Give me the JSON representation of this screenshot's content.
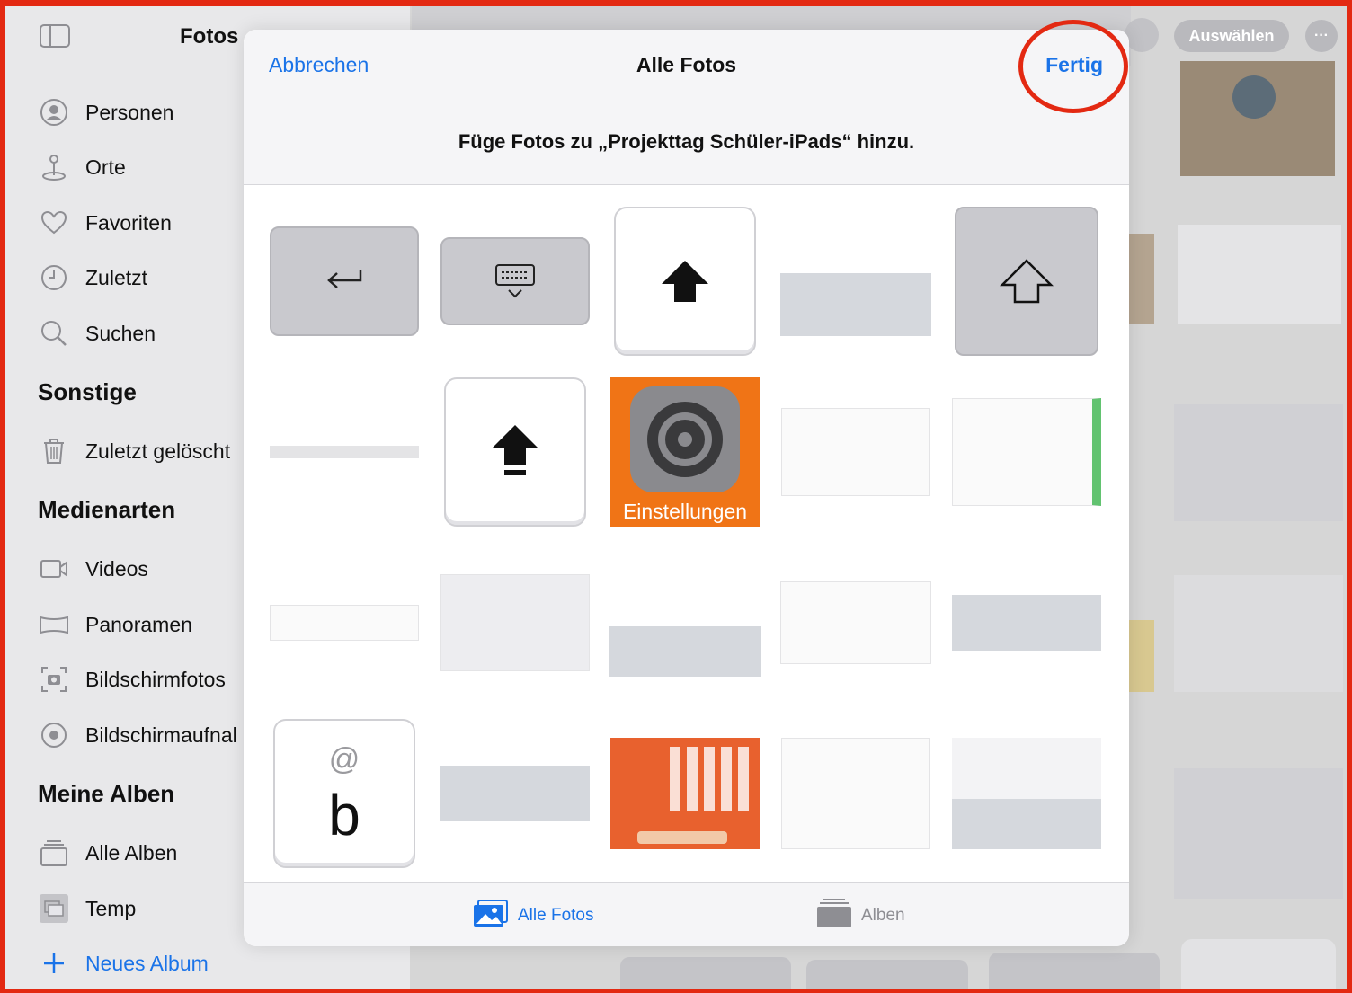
{
  "sidebar": {
    "title": "Fotos",
    "items": [
      {
        "label": "Personen",
        "icon": "person-circle-icon"
      },
      {
        "label": "Orte",
        "icon": "map-pin-icon"
      },
      {
        "label": "Favoriten",
        "icon": "heart-icon"
      },
      {
        "label": "Zuletzt",
        "icon": "clock-icon"
      },
      {
        "label": "Suchen",
        "icon": "search-icon"
      }
    ],
    "sections": {
      "other": "Sonstige",
      "media_types": "Medienarten",
      "my_albums": "Meine Alben"
    },
    "other_items": [
      {
        "label": "Zuletzt gelöscht",
        "icon": "trash-icon"
      }
    ],
    "media_items": [
      {
        "label": "Videos",
        "icon": "video-icon"
      },
      {
        "label": "Panoramen",
        "icon": "panorama-icon"
      },
      {
        "label": "Bildschirmfotos",
        "icon": "screenshot-icon"
      },
      {
        "label": "Bildschirmaufnal",
        "icon": "screen-recording-icon"
      }
    ],
    "album_items": [
      {
        "label": "Alle Alben",
        "icon": "albums-stack-icon"
      },
      {
        "label": "Temp",
        "icon": "album-thumbnail-icon"
      }
    ],
    "new_album": "Neues Album"
  },
  "background": {
    "select_button": "Auswählen",
    "more_button": "···"
  },
  "modal": {
    "cancel": "Abbrechen",
    "title": "Alle Fotos",
    "done": "Fertig",
    "prompt": "Füge Fotos zu „Projekttag Schüler-iPads“ hinzu.",
    "tabs": [
      {
        "label": "Alle Fotos",
        "icon": "photos-icon"
      },
      {
        "label": "Alben",
        "icon": "albums-icon"
      }
    ],
    "thumbnails": {
      "settings_label": "Einstellungen",
      "b_key_top": "@",
      "b_key_main": "b"
    }
  },
  "colors": {
    "accent": "#1a73e8",
    "highlight": "#e32912"
  }
}
